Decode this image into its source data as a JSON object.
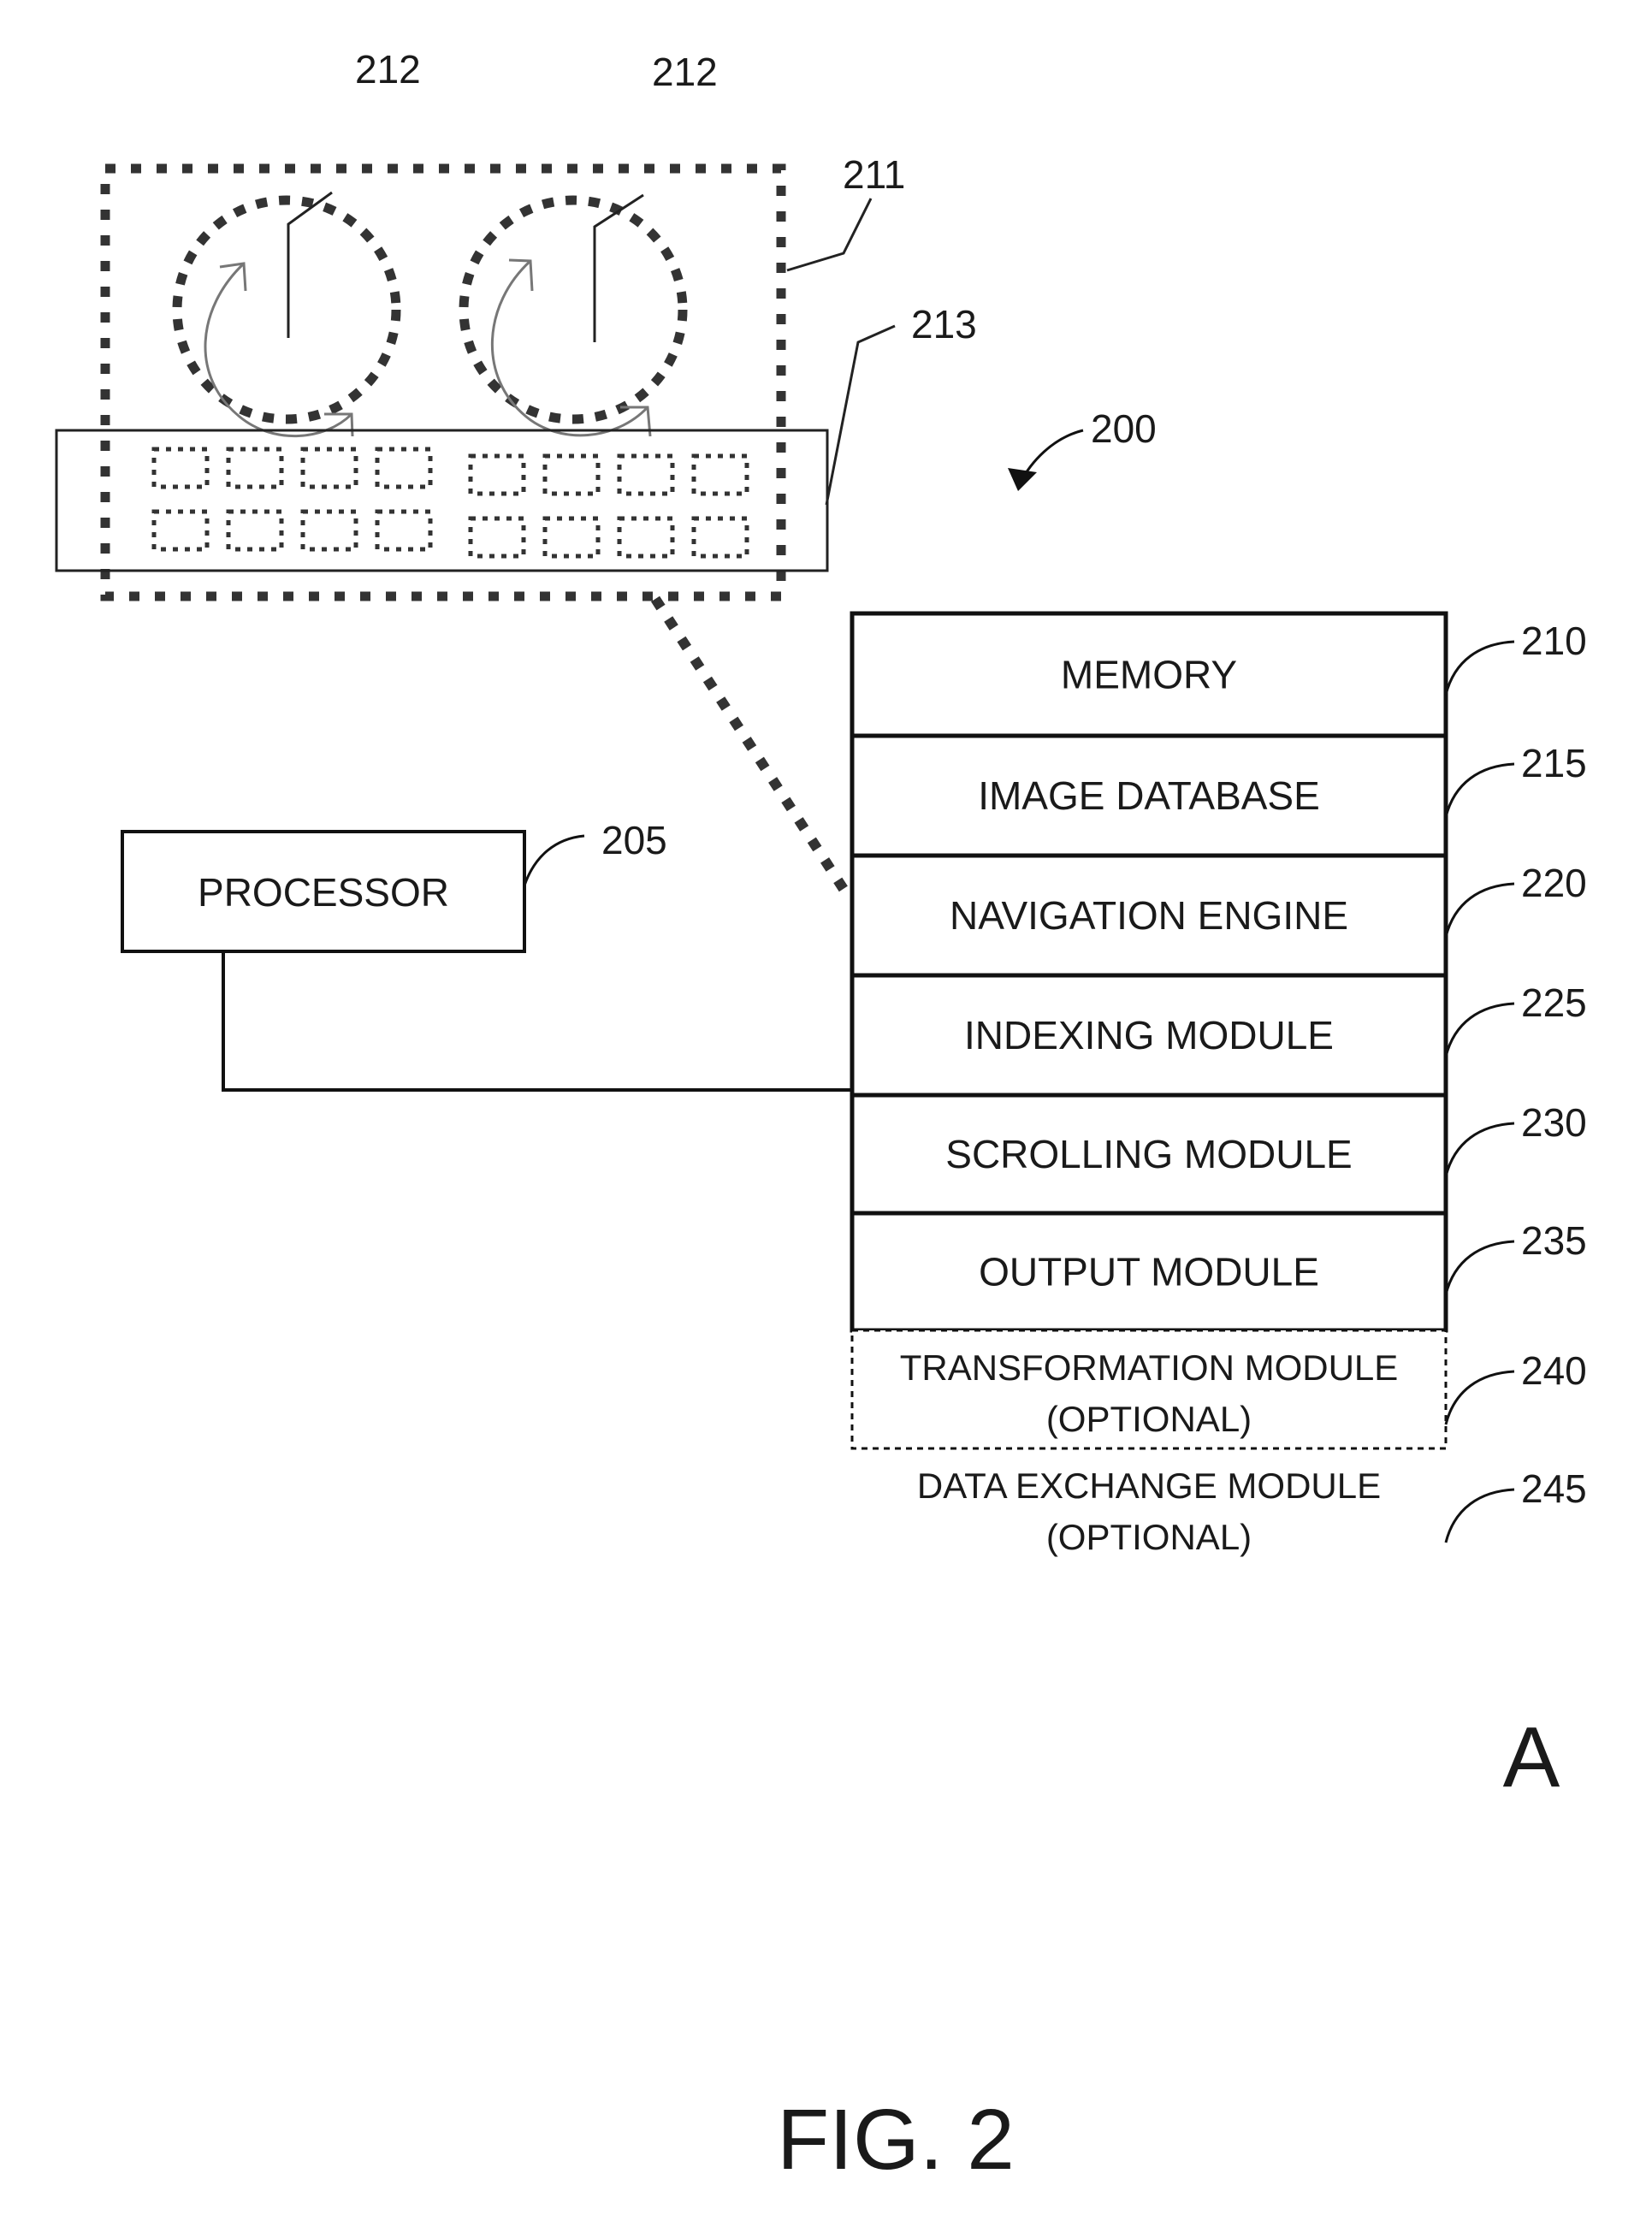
{
  "figure": {
    "title": "FIG. 2",
    "panel_letter": "A",
    "system_ref": "200"
  },
  "display": {
    "region_ref": "211",
    "wheel_ref": "212",
    "strip_ref": "213",
    "wheels": [
      {
        "name": "left-scroll-wheel",
        "ref": "212"
      },
      {
        "name": "right-scroll-wheel",
        "ref": "212"
      }
    ],
    "strip_groups": [
      {
        "rows": 2,
        "cols": 4
      },
      {
        "rows": 2,
        "cols": 4
      }
    ]
  },
  "processor": {
    "label": "PROCESSOR",
    "ref": "205"
  },
  "modules": [
    {
      "label": "MEMORY",
      "ref": "210",
      "optional": false
    },
    {
      "label": "IMAGE DATABASE",
      "ref": "215",
      "optional": false
    },
    {
      "label": "NAVIGATION ENGINE",
      "ref": "220",
      "optional": false
    },
    {
      "label": "INDEXING MODULE",
      "ref": "225",
      "optional": false
    },
    {
      "label": "SCROLLING MODULE",
      "ref": "230",
      "optional": false
    },
    {
      "label": "OUTPUT MODULE",
      "ref": "235",
      "optional": false
    },
    {
      "label": "TRANSFORMATION MODULE",
      "sublabel": "(OPTIONAL)",
      "ref": "240",
      "optional": true
    },
    {
      "label": "DATA EXCHANGE MODULE",
      "sublabel": "(OPTIONAL)",
      "ref": "245",
      "optional": true
    }
  ]
}
